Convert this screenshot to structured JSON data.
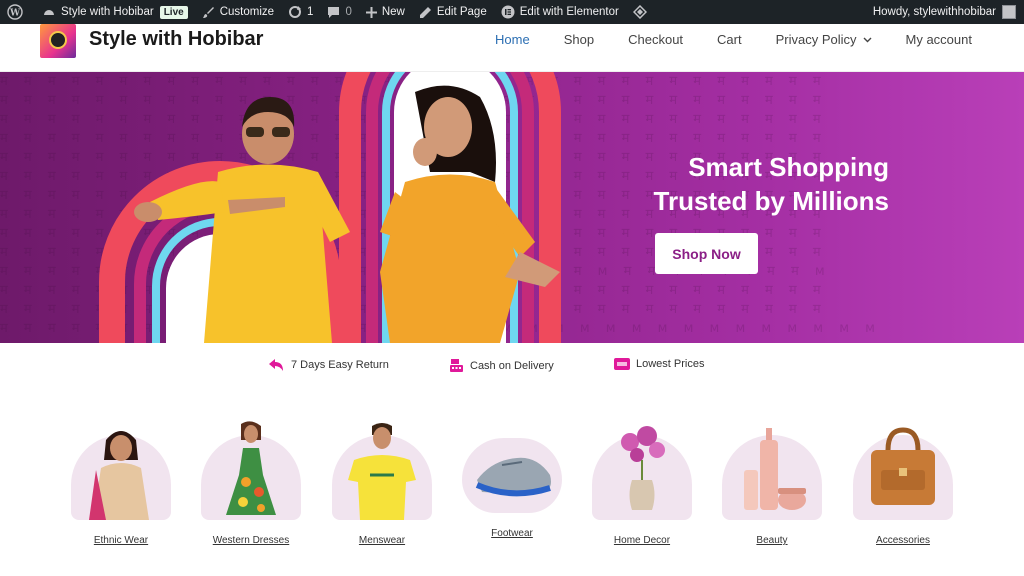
{
  "adminbar": {
    "site_name": "Style with Hobibar",
    "live_badge": "Live",
    "customize": "Customize",
    "updates_count": "1",
    "comments_count": "0",
    "new": "New",
    "edit_page": "Edit Page",
    "edit_elementor": "Edit with Elementor",
    "howdy": "Howdy, stylewithhobibar"
  },
  "header": {
    "site_title": "Style with Hobibar",
    "nav": [
      "Home",
      "Shop",
      "Checkout",
      "Cart",
      "Privacy Policy",
      "My account"
    ]
  },
  "hero": {
    "headline_line1": "Smart Shopping",
    "headline_line2": "Trusted by Millions",
    "cta": "Shop Now"
  },
  "features": [
    {
      "label": "7 Days Easy Return",
      "icon": "return-icon"
    },
    {
      "label": "Cash on Delivery",
      "icon": "cash-register-icon"
    },
    {
      "label": "Lowest Prices",
      "icon": "price-tag-icon"
    }
  ],
  "categories": [
    {
      "label": "Ethnic Wear"
    },
    {
      "label": "Western Dresses"
    },
    {
      "label": "Menswear"
    },
    {
      "label": "Footwear"
    },
    {
      "label": "Home Decor"
    },
    {
      "label": "Beauty"
    },
    {
      "label": "Accessories"
    }
  ],
  "colors": {
    "admin_bar": "#1d2327",
    "nav_active": "#2c6fb3",
    "hero_purple": "#8a2286",
    "feature_accent": "#e0199a",
    "category_bg": "#f1e4ef"
  }
}
